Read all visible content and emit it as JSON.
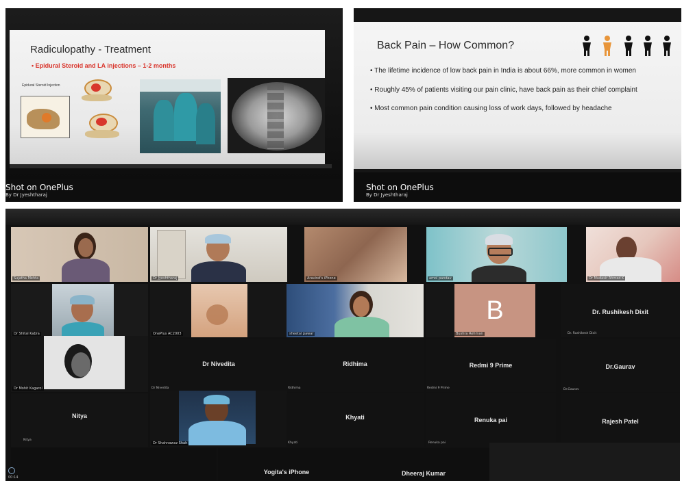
{
  "photo_left": {
    "slide_title": "Radiculopathy - Treatment",
    "slide_bullet": "Epidural Steroid and LA injections – 1-2 months",
    "diagram_label": "Epidural Steroid Injection",
    "watermark": "Shot on OnePlus",
    "watermark_sub": "By Dr Jyeshtharaj"
  },
  "photo_right": {
    "slide_title": "Back Pain – How Common?",
    "bullets": [
      "The lifetime incidence of low back pain in India is about 66%, more common in women",
      "Roughly 45% of patients visiting our pain clinic, have back pain as their chief complaint",
      "Most common pain condition causing loss of work days, followed by headache"
    ],
    "watermark": "Shot on OnePlus",
    "watermark_sub": "By Dr Jyeshtharaj",
    "icon_colors": [
      "#111111",
      "#e8953a",
      "#111111",
      "#111111",
      "#111111"
    ]
  },
  "meeting": {
    "video_tiles": [
      {
        "name": "Sujatha Mehta"
      },
      {
        "name": "Dr Jyeshtharaj"
      },
      {
        "name": "Aravind's iPhone"
      },
      {
        "name": "amol pandav"
      },
      {
        "name": "Dr Mudasir Ahmed K"
      },
      {
        "name": "Dr Shital Kabra"
      },
      {
        "name": "OnePlus AC2003"
      },
      {
        "name": "sheetal pawar"
      },
      {
        "name": "Bushra Rehman"
      },
      {
        "name": "Dr Mohit Kagarol"
      },
      {
        "name": "Dr Shahnawaz Shah"
      }
    ],
    "avatar_letter": "B",
    "name_tiles": [
      {
        "center": "Dr. Rushikesh Dixit",
        "small": "Dr. Rushikesh Dixit"
      },
      {
        "center": "Dr Nivedita",
        "small": "Dr Nivedita"
      },
      {
        "center": "Ridhima",
        "small": "Ridhima"
      },
      {
        "center": "Redmi 9 Prime",
        "small": "Redmi 9 Prime"
      },
      {
        "center": "Dr.Gaurav",
        "small": "Dr.Gaurav"
      },
      {
        "center": "Nitya",
        "small": "Nitya"
      },
      {
        "center": "Khyati",
        "small": "Khyati"
      },
      {
        "center": "Renuka pai",
        "small": "Renuka pai"
      },
      {
        "center": "Rajesh Patel",
        "small": "Rajesh Patel"
      },
      {
        "center": "Yogita's iPhone",
        "small": ""
      },
      {
        "center": "Dheeraj Kumar",
        "small": ""
      }
    ],
    "timer": "00:14"
  }
}
